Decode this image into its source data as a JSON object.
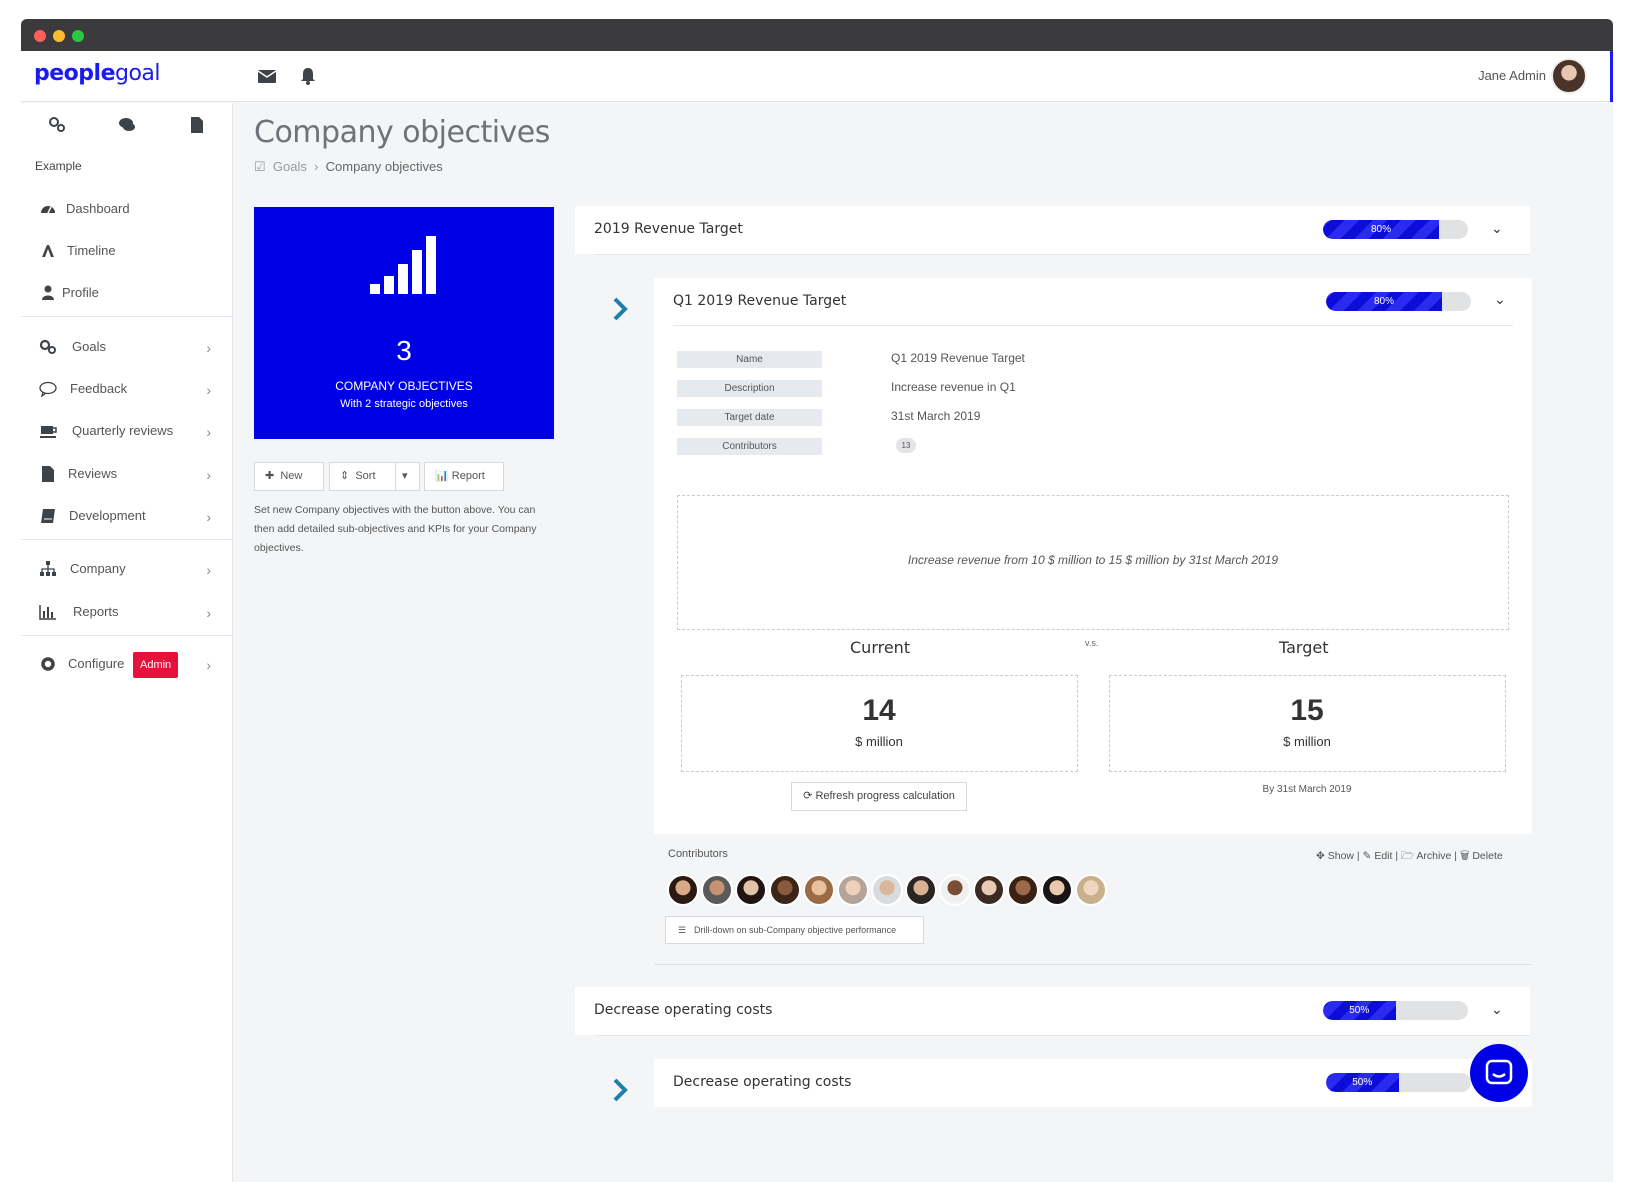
{
  "topbar": {
    "logo_bold": "people",
    "logo_light": "goal",
    "user_name": "Jane Admin"
  },
  "sidebar": {
    "section_label": "Example",
    "items": [
      {
        "label": "Dashboard",
        "icon": "dashboard-icon"
      },
      {
        "label": "Timeline",
        "icon": "timeline-icon"
      },
      {
        "label": "Profile",
        "icon": "user-icon"
      },
      {
        "label": "Goals",
        "icon": "gears-icon"
      },
      {
        "label": "Feedback",
        "icon": "chat-bubble-icon"
      },
      {
        "label": "Quarterly reviews",
        "icon": "coffee-icon"
      },
      {
        "label": "Reviews",
        "icon": "document-icon"
      },
      {
        "label": "Development",
        "icon": "book-icon"
      },
      {
        "label": "Company",
        "icon": "org-chart-icon"
      },
      {
        "label": "Reports",
        "icon": "bar-chart-icon"
      },
      {
        "label": "Configure",
        "icon": "gear-icon",
        "badge": "Admin"
      }
    ]
  },
  "page": {
    "title": "Company objectives",
    "breadcrumb_root": "Goals",
    "breadcrumb_current": "Company objectives"
  },
  "hero": {
    "count": "3",
    "label": "COMPANY OBJECTIVES",
    "sublabel": "With 2 strategic objectives",
    "color": "#0000e6"
  },
  "toolbar": {
    "new_label": "New",
    "sort_label": "Sort",
    "report_label": "Report"
  },
  "help_text": "Set new Company objectives with the button above. You can then add detailed sub-objectives and KPIs for your Company objectives.",
  "objectives": [
    {
      "title": "2019 Revenue Target",
      "progress": 80,
      "progress_label": "80%"
    },
    {
      "title": "Decrease operating costs",
      "progress": 50,
      "progress_label": "50%"
    }
  ],
  "sub_objectives": [
    {
      "title": "Q1 2019 Revenue Target",
      "progress": 80,
      "progress_label": "80%"
    },
    {
      "title": "Decrease operating costs",
      "progress": 50,
      "progress_label": "50%"
    }
  ],
  "details": {
    "name_label": "Name",
    "name_value": "Q1 2019 Revenue Target",
    "description_label": "Description",
    "description_value": "Increase revenue in Q1",
    "target_date_label": "Target date",
    "target_date_value": "31st March 2019",
    "contributors_label": "Contributors",
    "contributors_count": "13",
    "quote": "Increase revenue from 10 $ million to 15 $ million by 31st March 2019",
    "current_heading": "Current",
    "vs_label": "v.s.",
    "target_heading": "Target",
    "current_value": "14",
    "current_unit": "$ million",
    "target_value": "15",
    "target_unit": "$ million",
    "refresh_label": "Refresh progress calculation",
    "by_date": "By 31st March 2019"
  },
  "contributors": {
    "label": "Contributors",
    "action_show": "Show |",
    "action_edit": "Edit |",
    "action_archive": "Archive |",
    "action_delete": "Delete",
    "avatar_count": 13,
    "drill_label": "Drill-down on sub-Company objective performance"
  },
  "colors": {
    "brand": "#1a1af2",
    "accent_teal": "#1f7fa8",
    "admin_badge": "#e8113c"
  }
}
